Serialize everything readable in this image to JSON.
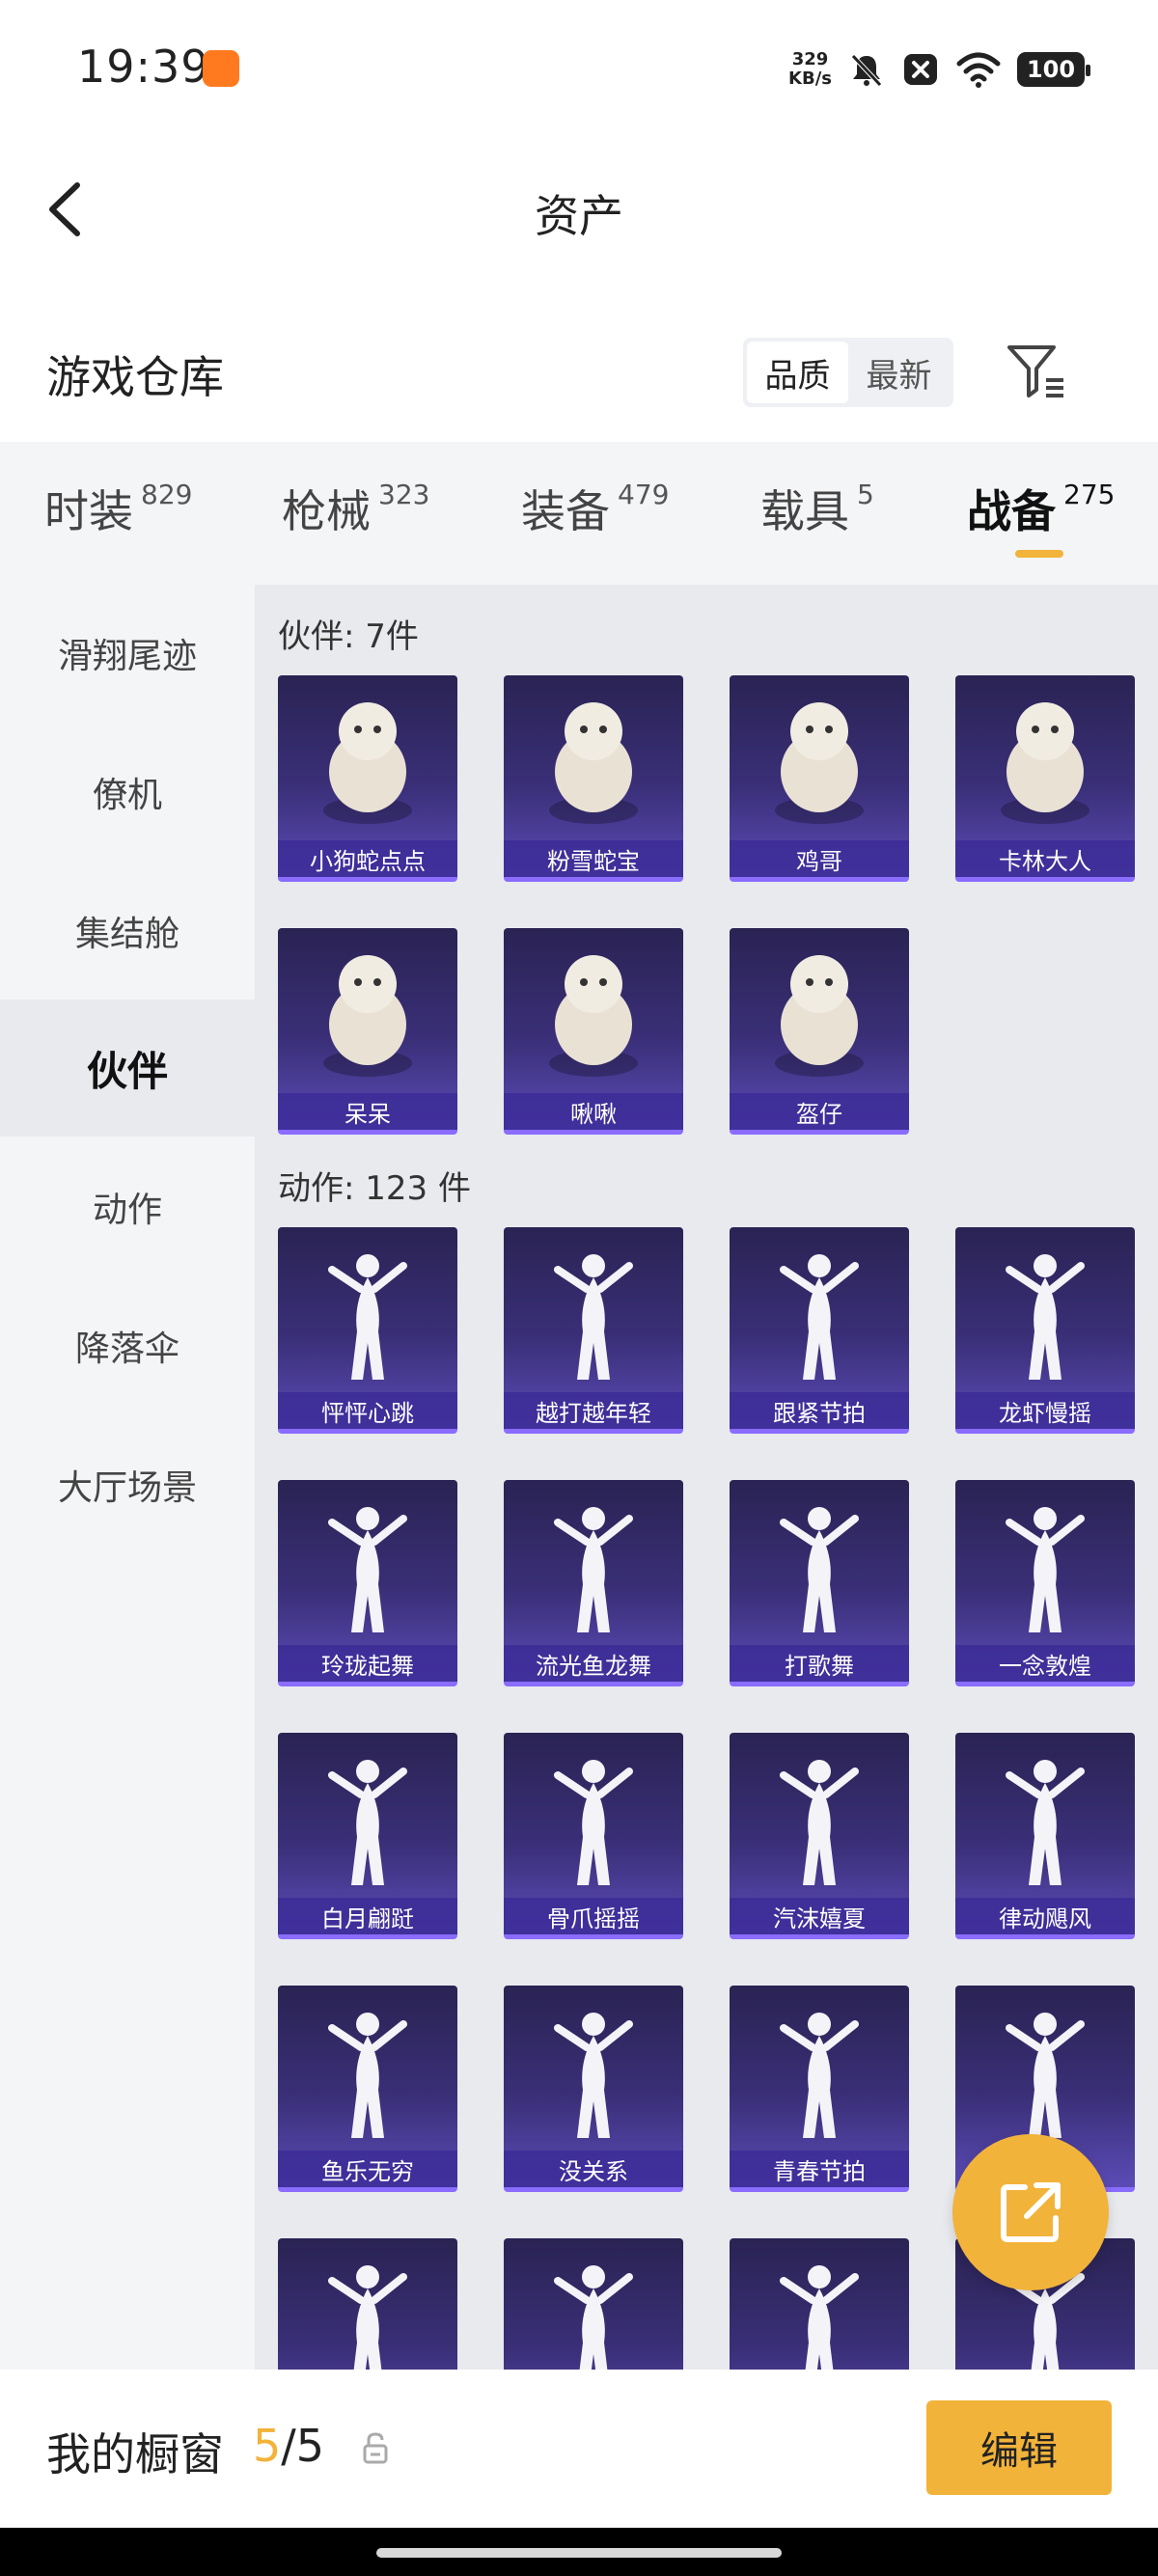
{
  "status_bar": {
    "time": "19:39",
    "net_speed_value": "329",
    "net_speed_unit": "KB/s",
    "battery": "100",
    "icons": [
      "app-notification-icon",
      "mute-icon",
      "close-box-icon",
      "wifi-icon",
      "battery-icon"
    ]
  },
  "header": {
    "title": "资产",
    "back_icon": "chevron-left-icon"
  },
  "warehouse": {
    "title": "游戏仓库",
    "sort_options": [
      "品质",
      "最新"
    ],
    "sort_selected": "品质",
    "filter_icon": "filter-icon"
  },
  "tabs": [
    {
      "label": "时装",
      "count": "829"
    },
    {
      "label": "枪械",
      "count": "323"
    },
    {
      "label": "装备",
      "count": "479"
    },
    {
      "label": "载具",
      "count": "5"
    },
    {
      "label": "战备",
      "count": "275",
      "active": true
    }
  ],
  "sidebar": [
    {
      "label": "滑翔尾迹"
    },
    {
      "label": "僚机"
    },
    {
      "label": "集结舱"
    },
    {
      "label": "伙伴",
      "active": true
    },
    {
      "label": "动作"
    },
    {
      "label": "降落伞"
    },
    {
      "label": "大厅场景"
    }
  ],
  "sections": [
    {
      "title": "伙伴: 7件",
      "items": [
        "小狗蛇点点",
        "粉雪蛇宝",
        "鸡哥",
        "卡林大人",
        "呆呆",
        "啾啾",
        "盔仔"
      ]
    },
    {
      "title": "动作: 123 件",
      "items": [
        "怦怦心跳",
        "越打越年轻",
        "跟紧节拍",
        "龙虾慢摇",
        "玲珑起舞",
        "流光鱼龙舞",
        "打歌舞",
        "一念敦煌",
        "白月翩跹",
        "骨爪摇摇",
        "汽沫嬉夏",
        "律动飓风",
        "鱼乐无穷",
        "没关系",
        "青春节拍",
        "",
        "",
        "",
        "",
        ""
      ]
    }
  ],
  "share_button_icon": "share-external-icon",
  "bottom_bar": {
    "label": "我的橱窗",
    "current": "5",
    "separator": "/",
    "total": "5",
    "lock_icon": "lock-icon",
    "edit_label": "编辑"
  },
  "colors": {
    "accent": "#f2b33a",
    "card_top": "#2a2353",
    "card_bottom": "#5b4bb6",
    "card_border": "#8a6cff"
  }
}
